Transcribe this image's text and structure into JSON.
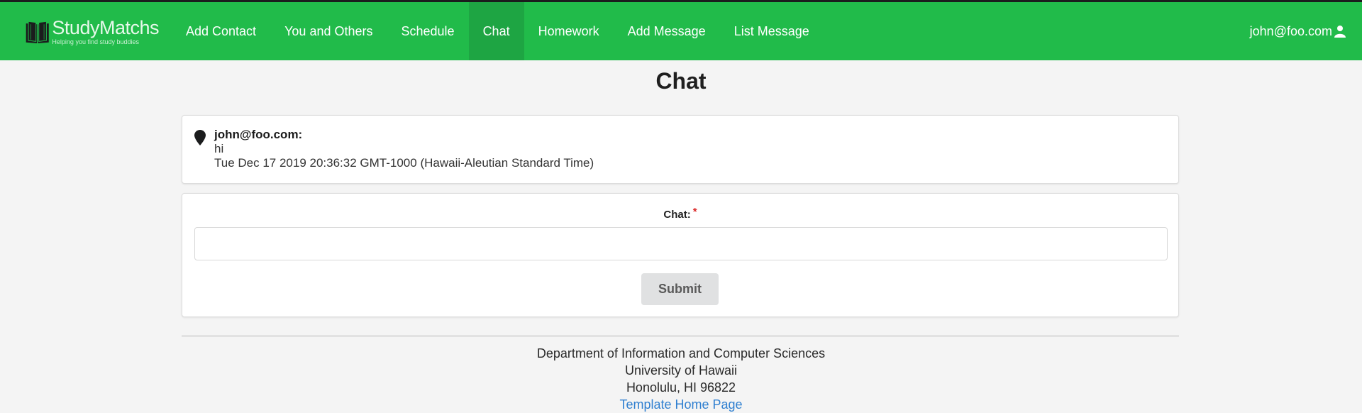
{
  "brand": {
    "name": "StudyMatchs",
    "tagline": "Helping you find study buddies"
  },
  "nav": {
    "items": [
      {
        "label": "Add Contact",
        "active": false
      },
      {
        "label": "You and Others",
        "active": false
      },
      {
        "label": "Schedule",
        "active": false
      },
      {
        "label": "Chat",
        "active": true
      },
      {
        "label": "Homework",
        "active": false
      },
      {
        "label": "Add Message",
        "active": false
      },
      {
        "label": "List Message",
        "active": false
      }
    ],
    "user": "john@foo.com"
  },
  "page": {
    "title": "Chat"
  },
  "messages": [
    {
      "sender": "john@foo.com:",
      "text": "hi",
      "timestamp": "Tue Dec 17 2019 20:36:32 GMT-1000 (Hawaii-Aleutian Standard Time)"
    }
  ],
  "form": {
    "label": "Chat:",
    "required_mark": "*",
    "value": "",
    "placeholder": "",
    "submit_label": "Submit"
  },
  "footer": {
    "line1": "Department of Information and Computer Sciences",
    "line2": "University of Hawaii",
    "line3": "Honolulu, HI 96822",
    "link": "Template Home Page"
  },
  "colors": {
    "navbar": "#21bb4a",
    "navbar_active": "#1ea543",
    "required": "#db2828",
    "link": "#2f7fd0"
  },
  "icons": {
    "logo": "book-icon",
    "user": "user-icon",
    "message": "map-marker-icon"
  }
}
